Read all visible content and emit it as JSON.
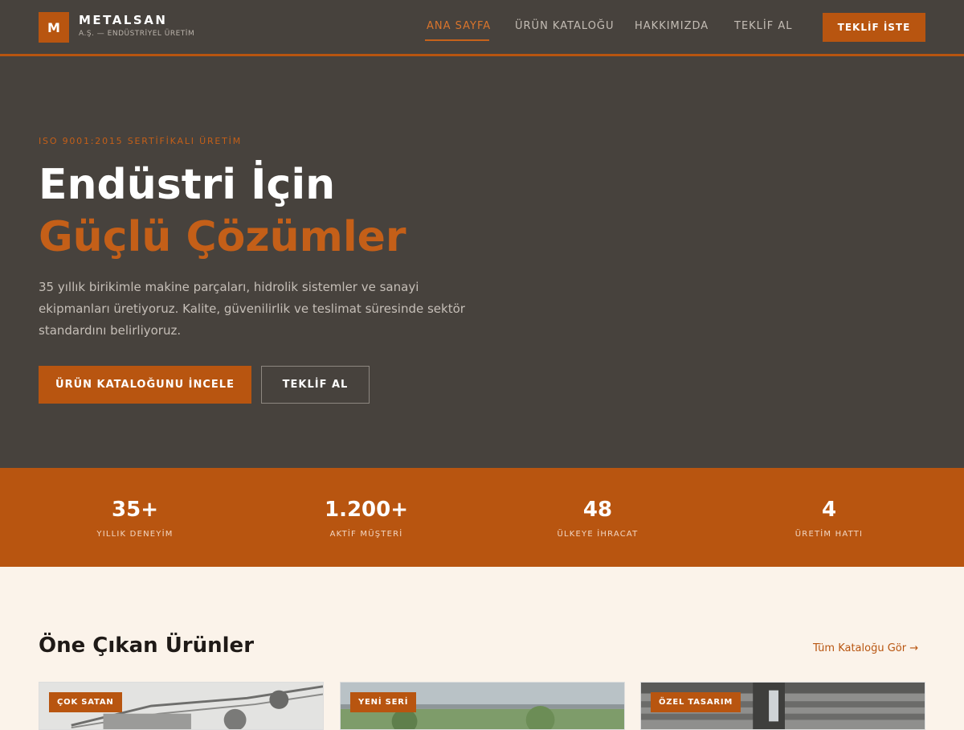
{
  "header": {
    "logo_letter": "M",
    "brand_name": "METALSAN",
    "brand_sub": "A.Ş. — ENDÜSTRİYEL ÜRETİM",
    "nav": [
      "ANA SAYFA",
      "ÜRÜN KATALOĞU",
      "HAKKIMIZDA",
      "TEKLİF AL"
    ],
    "active_nav": "ANA SAYFA",
    "cta": "TEKLİF İSTE"
  },
  "hero": {
    "eyebrow": "ISO 9001:2015 SERTİFİKALI ÜRETİM",
    "title_line1": "Endüstri İçin",
    "title_line2": "Güçlü Çözümler",
    "description": "35 yıllık birikimle makine parçaları, hidrolik sistemler ve sanayi ekipmanları üretiyoruz. Kalite, güvenilirlik ve teslimat süresinde sektör standardını belirliyoruz.",
    "primary_button": "ÜRÜN KATALOĞUNU İNCELE",
    "secondary_button": "TEKLİF AL"
  },
  "stats": [
    {
      "value": "35+",
      "label": "YILLIK DENEYİM"
    },
    {
      "value": "1.200+",
      "label": "AKTİF MÜŞTERİ"
    },
    {
      "value": "48",
      "label": "ÜLKEYE İHRACAT"
    },
    {
      "value": "4",
      "label": "ÜRETİM HATTI"
    }
  ],
  "products": {
    "title": "Öne Çıkan Ürünler",
    "see_all": "Tüm Kataloğu Gör →",
    "cards": [
      {
        "badge": "ÇOK SATAN"
      },
      {
        "badge": "YENİ SERİ"
      },
      {
        "badge": "ÖZEL TASARIM"
      }
    ]
  },
  "colors": {
    "accent": "#b85510",
    "dark": "#47423d",
    "background": "#fbf3ea"
  }
}
